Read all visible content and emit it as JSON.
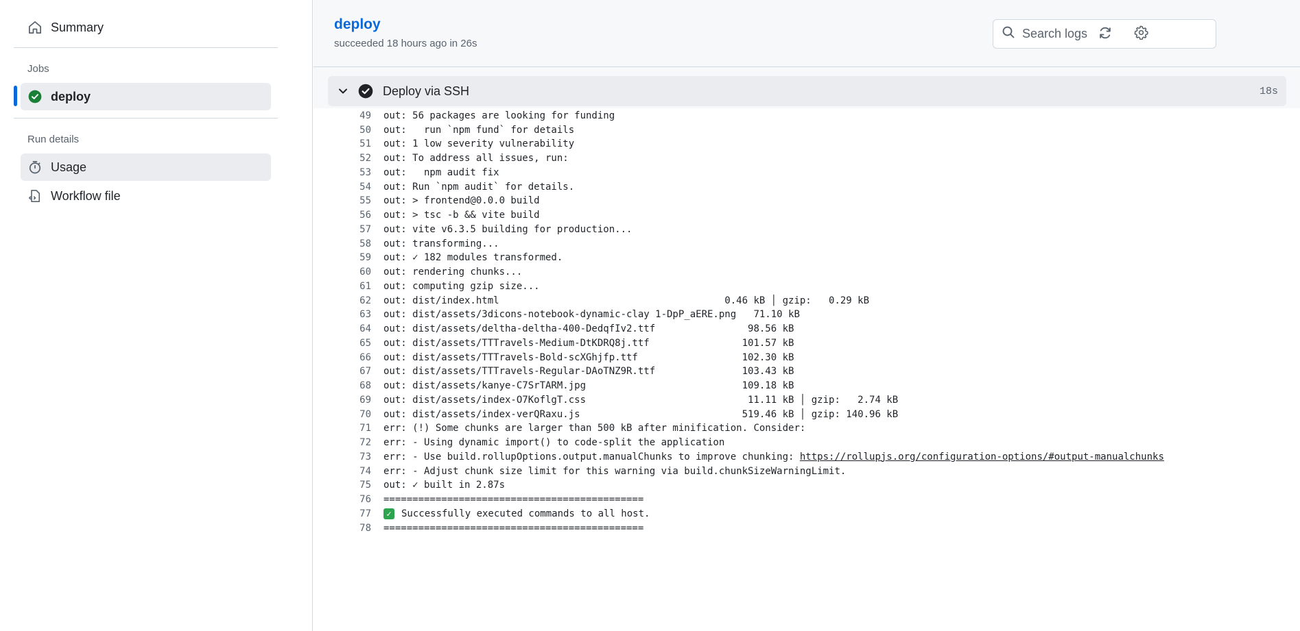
{
  "sidebar": {
    "summary_label": "Summary",
    "jobs_heading": "Jobs",
    "job_label": "deploy",
    "run_details_heading": "Run details",
    "usage_label": "Usage",
    "workflow_file_label": "Workflow file"
  },
  "header": {
    "title": "deploy",
    "subtitle": "succeeded 18 hours ago in 26s",
    "search_placeholder": "Search logs"
  },
  "step": {
    "name": "Deploy via SSH",
    "duration": "18s"
  },
  "log_lines": [
    {
      "n": "49",
      "text": "out: 56 packages are looking for funding"
    },
    {
      "n": "50",
      "text": "out:   run `npm fund` for details"
    },
    {
      "n": "51",
      "text": "out: 1 low severity vulnerability"
    },
    {
      "n": "52",
      "text": "out: To address all issues, run:"
    },
    {
      "n": "53",
      "text": "out:   npm audit fix"
    },
    {
      "n": "54",
      "text": "out: Run `npm audit` for details."
    },
    {
      "n": "55",
      "text": "out: > frontend@0.0.0 build"
    },
    {
      "n": "56",
      "text": "out: > tsc -b && vite build"
    },
    {
      "n": "57",
      "text": "out: vite v6.3.5 building for production..."
    },
    {
      "n": "58",
      "text": "out: transforming..."
    },
    {
      "n": "59",
      "text": "out: ✓ 182 modules transformed."
    },
    {
      "n": "60",
      "text": "out: rendering chunks..."
    },
    {
      "n": "61",
      "text": "out: computing gzip size..."
    },
    {
      "n": "62",
      "text": "out: dist/index.html                                       0.46 kB │ gzip:   0.29 kB"
    },
    {
      "n": "63",
      "text": "out: dist/assets/3dicons-notebook-dynamic-clay 1-DpP_aERE.png   71.10 kB"
    },
    {
      "n": "64",
      "text": "out: dist/assets/deltha-deltha-400-DedqfIv2.ttf                98.56 kB"
    },
    {
      "n": "65",
      "text": "out: dist/assets/TTTravels-Medium-DtKDRQ8j.ttf                101.57 kB"
    },
    {
      "n": "66",
      "text": "out: dist/assets/TTTravels-Bold-scXGhjfp.ttf                  102.30 kB"
    },
    {
      "n": "67",
      "text": "out: dist/assets/TTTravels-Regular-DAoTNZ9R.ttf               103.43 kB"
    },
    {
      "n": "68",
      "text": "out: dist/assets/kanye-C7SrTARM.jpg                           109.18 kB"
    },
    {
      "n": "69",
      "text": "out: dist/assets/index-O7KoflgT.css                            11.11 kB │ gzip:   2.74 kB"
    },
    {
      "n": "70",
      "text": "out: dist/assets/index-verQRaxu.js                            519.46 kB │ gzip: 140.96 kB"
    },
    {
      "n": "71",
      "text": "err: (!) Some chunks are larger than 500 kB after minification. Consider:"
    },
    {
      "n": "72",
      "text": "err: - Using dynamic import() to code-split the application"
    },
    {
      "n": "73",
      "text": "err: - Use build.rollupOptions.output.manualChunks to improve chunking: ",
      "link": "https://rollupjs.org/configuration-options/#output-manualchunks"
    },
    {
      "n": "74",
      "text": "err: - Adjust chunk size limit for this warning via build.chunkSizeWarningLimit."
    },
    {
      "n": "75",
      "text": "out: ✓ built in 2.87s"
    },
    {
      "n": "76",
      "text": "============================================="
    },
    {
      "n": "77",
      "text": "Successfully executed commands to all host.",
      "checkbox": true
    },
    {
      "n": "78",
      "text": "============================================="
    }
  ],
  "colors": {
    "accent": "#0969da",
    "success": "#1a7f37",
    "checkbox": "#2da44e"
  },
  "icons": {
    "summary": "home-icon",
    "job_status": "check-circle-icon",
    "usage": "stopwatch-icon",
    "workflow_file": "file-code-icon",
    "search": "search-icon",
    "refresh": "refresh-icon",
    "settings": "gear-icon",
    "step_toggle": "chevron-down-icon",
    "step_status": "check-circle-filled-icon"
  }
}
